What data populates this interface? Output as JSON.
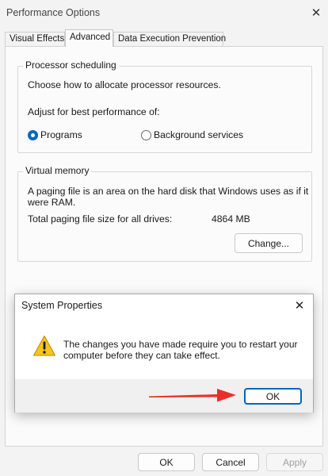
{
  "window": {
    "title": "Performance Options",
    "close_glyph": "✕",
    "tabs": [
      {
        "label": "Visual Effects",
        "active": false
      },
      {
        "label": "Advanced",
        "active": true
      },
      {
        "label": "Data Execution Prevention",
        "active": false
      }
    ]
  },
  "processor_scheduling": {
    "legend": "Processor scheduling",
    "description": "Choose how to allocate processor resources.",
    "adjust_label": "Adjust for best performance of:",
    "options": [
      {
        "label": "Programs",
        "checked": true
      },
      {
        "label": "Background services",
        "checked": false
      }
    ]
  },
  "virtual_memory": {
    "legend": "Virtual memory",
    "description_line1": "A paging file is an area on the hard disk that Windows uses as if it",
    "description_line2": "were RAM.",
    "total_label": "Total paging file size for all drives:",
    "total_value": "4864 MB",
    "change_button": "Change..."
  },
  "footer_buttons": {
    "ok": "OK",
    "cancel": "Cancel",
    "apply": "Apply"
  },
  "dialog": {
    "title": "System Properties",
    "close_glyph": "✕",
    "icon": "warning-icon",
    "message_line1": "The changes you have made require you to restart your",
    "message_line2": "computer before they can take effect.",
    "ok_button": "OK"
  },
  "annotation": {
    "arrow_color": "#e8302a"
  },
  "colors": {
    "accent": "#0067c0",
    "warning_yellow": "#f7c51c"
  }
}
